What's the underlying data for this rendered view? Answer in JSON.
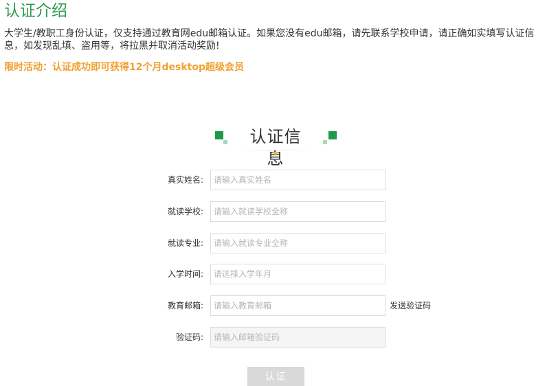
{
  "page": {
    "title": "认证介绍",
    "intro": "大学生/教职工身份认证，仅支持通过教育网edu邮箱认证。如果您没有edu邮箱，请先联系学校申请，请正确如实填写认证信息，如发现乱填、盗用等，将拉黑并取消活动奖励!",
    "promo": "限时活动：认证成功即可获得12个月desktop超级会员"
  },
  "section": {
    "title": "认证信息"
  },
  "colors": {
    "brand_green": "#2f9b4f",
    "promo_orange": "#f0a030",
    "caret_orange": "#f0b24a",
    "button_disabled": "#d9d9d9"
  },
  "form": {
    "name": {
      "label": "真实姓名:",
      "placeholder": "请输入真实姓名",
      "value": ""
    },
    "school": {
      "label": "就读学校:",
      "placeholder": "请输入就读学校全称",
      "value": ""
    },
    "major": {
      "label": "就读专业:",
      "placeholder": "请输入就读专业全称",
      "value": ""
    },
    "enroll": {
      "label": "入学时间:",
      "placeholder": "请选择入学年月",
      "value": ""
    },
    "email": {
      "label": "教育邮箱:",
      "placeholder": "请输入教育邮箱",
      "value": "",
      "send_code": "发送验证码"
    },
    "code": {
      "label": "验证码:",
      "placeholder": "请输入邮箱验证码",
      "value": ""
    },
    "submit_label": "认证"
  }
}
